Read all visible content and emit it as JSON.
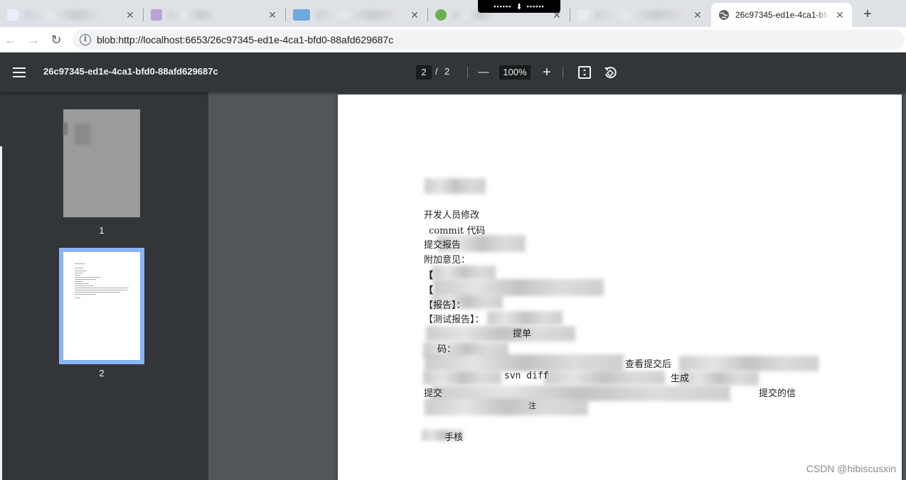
{
  "browser": {
    "active_tab_title": "26c97345-ed1e-4ca1-bfd0-88afd629687c",
    "url": "blob:http://localhost:6653/26c97345-ed1e-4ca1-bfd0-88afd629687c",
    "close_glyph": "✕",
    "new_tab_glyph": "+",
    "back_glyph": "←",
    "forward_glyph": "→",
    "reload_glyph": "↻",
    "info_glyph": "i",
    "download_glyph": "⬇",
    "download_dots": "▪▪▪▪▪▪",
    "icons": [
      "back-arrow-icon",
      "forward-arrow-icon",
      "reload-icon",
      "info-icon",
      "globe-icon",
      "close-icon",
      "plus-icon",
      "download-icon"
    ]
  },
  "pdf_toolbar": {
    "title": "26c97345-ed1e-4ca1-bfd0-88afd629687c",
    "current_page": "2",
    "page_separator": "/",
    "total_pages": "2",
    "zoom": "100%",
    "zoom_out_glyph": "—",
    "zoom_in_glyph": "+",
    "icons": [
      "menu-icon",
      "zoom-out-icon",
      "zoom-in-icon",
      "fit-page-icon",
      "rotate-icon"
    ]
  },
  "sidebar": {
    "thumbnails": [
      {
        "label": "1",
        "selected": false
      },
      {
        "label": "2",
        "selected": true
      }
    ],
    "selected_color": "#8ab4f8"
  },
  "document": {
    "visible_lines": [
      "开发人员修改",
      "commit 代码",
      "提交报告",
      "附加意见：",
      "【",
      "【",
      "【报告】：",
      "【测试报告】：",
      "提单",
      "码：",
      "查看提交后",
      "svn diff",
      "生成",
      "提交",
      "提交的信",
      "注",
      "手核"
    ]
  },
  "watermark": "CSDN @hibiscusxin"
}
